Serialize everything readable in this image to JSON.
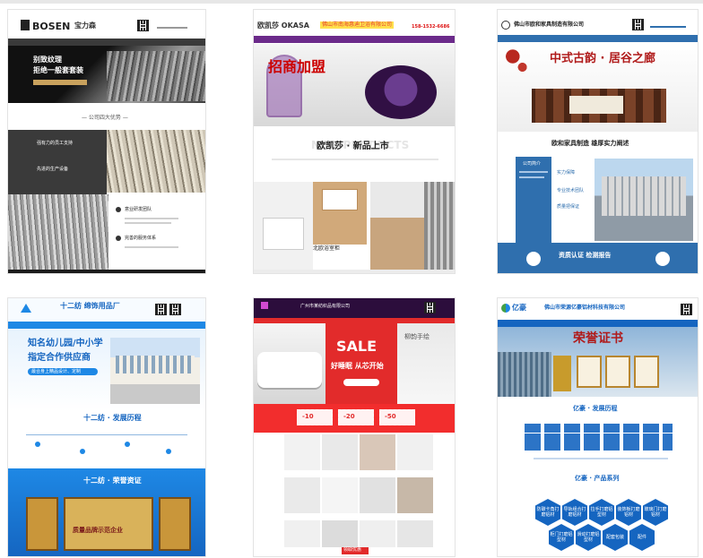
{
  "page": {
    "accent_colors": {
      "bosen": "#1c1c1c",
      "okasa": "#6b2a8a",
      "furniture": "#2f6fae",
      "twelve": "#1e88e5",
      "bedding": "#e22b2b",
      "yiyuan": "#1565c0"
    }
  },
  "t1": {
    "logo": "BOSEN",
    "logo_cn": "宝力森",
    "hero_line1": "别致纹理",
    "hero_line2": "拒绝一般套套装",
    "section_title": "— 公司四大优势 —",
    "adv1": "强有力的员工支持",
    "adv2": "先进的生产设备",
    "adv3": "意业研发团队",
    "adv4": "完善的服务体系",
    "icon_names": [
      "gear-icon",
      "gear-icon",
      "gear-icon",
      "gear-icon"
    ]
  },
  "t2": {
    "logo": "欧凯莎 OKASA",
    "company": "佛山市南海惠迪卫浴有限公司",
    "phone": "158-1532-6686",
    "hero": "招商加盟",
    "title": "欧凯莎 · 新品上市",
    "watermark": "NEW PRODUCTS",
    "model": "北欧浴室柜"
  },
  "t3": {
    "company": "佛山市欧和家具制造有限公司",
    "hero": "中式古韵 · 居谷之廊",
    "headline": "欧和家具制造  雄厚实力阐述",
    "subhead": "公司简介",
    "bullet1": "实力保障",
    "bullet2": "专业技术团队",
    "bullet3": "质量把保证",
    "banner": "资质认证  检测报告"
  },
  "t4": {
    "company": "十二纺 绵饰用品厂",
    "hero_line1": "知名幼儿园/中小学",
    "hero_line2": "指定合作供应商",
    "hero_note": "最合身上精品设计、定制",
    "history": "十二纺 · 发展历程",
    "honor": "十二纺 · 荣誉资证",
    "certificate": "质量品牌示范企业"
  },
  "t5": {
    "company": "广州市某纺织品有限公司",
    "sale": "SALE",
    "slogan": "好睡眠 从芯开始",
    "brand_right": "柳韵手绘",
    "button": "领取优惠",
    "price_labels": [
      "-10",
      "-20",
      "-50"
    ]
  },
  "t6": {
    "logo": "亿豪",
    "company": "佛山市荣源亿豪铝材科技有限公司",
    "hero": "荣誉证书",
    "history": "亿豪 · 发展历程",
    "products": "亿豪 · 产品系列",
    "hex_items": [
      "防碳卡角打磨铝材",
      "导轨组合打磨铝材",
      "拉手打磨铝型材",
      "装饰板打磨铝材",
      "玻璃门打磨铝材",
      "柜门打磨铝型材",
      "滑动打磨铝型材",
      "配套包装",
      "配件"
    ]
  }
}
